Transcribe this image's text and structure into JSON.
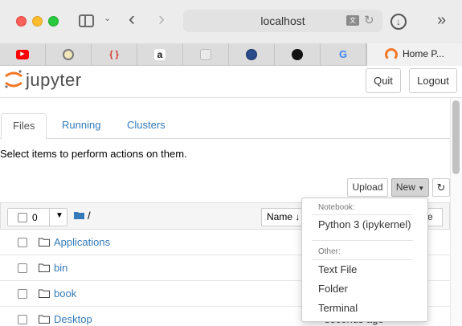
{
  "browser": {
    "url": "localhost",
    "active_tab_label": "Home P...",
    "favicons": [
      "youtube-icon",
      "pinwheel-icon",
      "braces-icon",
      "amazon-icon",
      "box-icon",
      "globe-seal-icon",
      "github-icon",
      "google-icon"
    ]
  },
  "header": {
    "logo_text": "jupyter",
    "quit_label": "Quit",
    "logout_label": "Logout"
  },
  "tabs": [
    {
      "label": "Files"
    },
    {
      "label": "Running"
    },
    {
      "label": "Clusters"
    }
  ],
  "hint": "Select items to perform actions on them.",
  "toolbar": {
    "upload_label": "Upload",
    "new_label": "New",
    "refresh_icon": "refresh-icon"
  },
  "list_header": {
    "selected_count": "0",
    "path": "/",
    "name_sort_label": "Name",
    "size_sort_partial": "ze"
  },
  "files": [
    {
      "name": "Applications"
    },
    {
      "name": "bin"
    },
    {
      "name": "book"
    },
    {
      "name": "Desktop",
      "modified": "seconds ago"
    }
  ],
  "new_menu": {
    "notebook_header": "Notebook:",
    "kernel_item": "Python 3 (ipykernel)",
    "other_header": "Other:",
    "items": [
      "Text File",
      "Folder",
      "Terminal"
    ]
  },
  "colors": {
    "link": "#337ab7",
    "jupyter_orange": "#f37726"
  }
}
